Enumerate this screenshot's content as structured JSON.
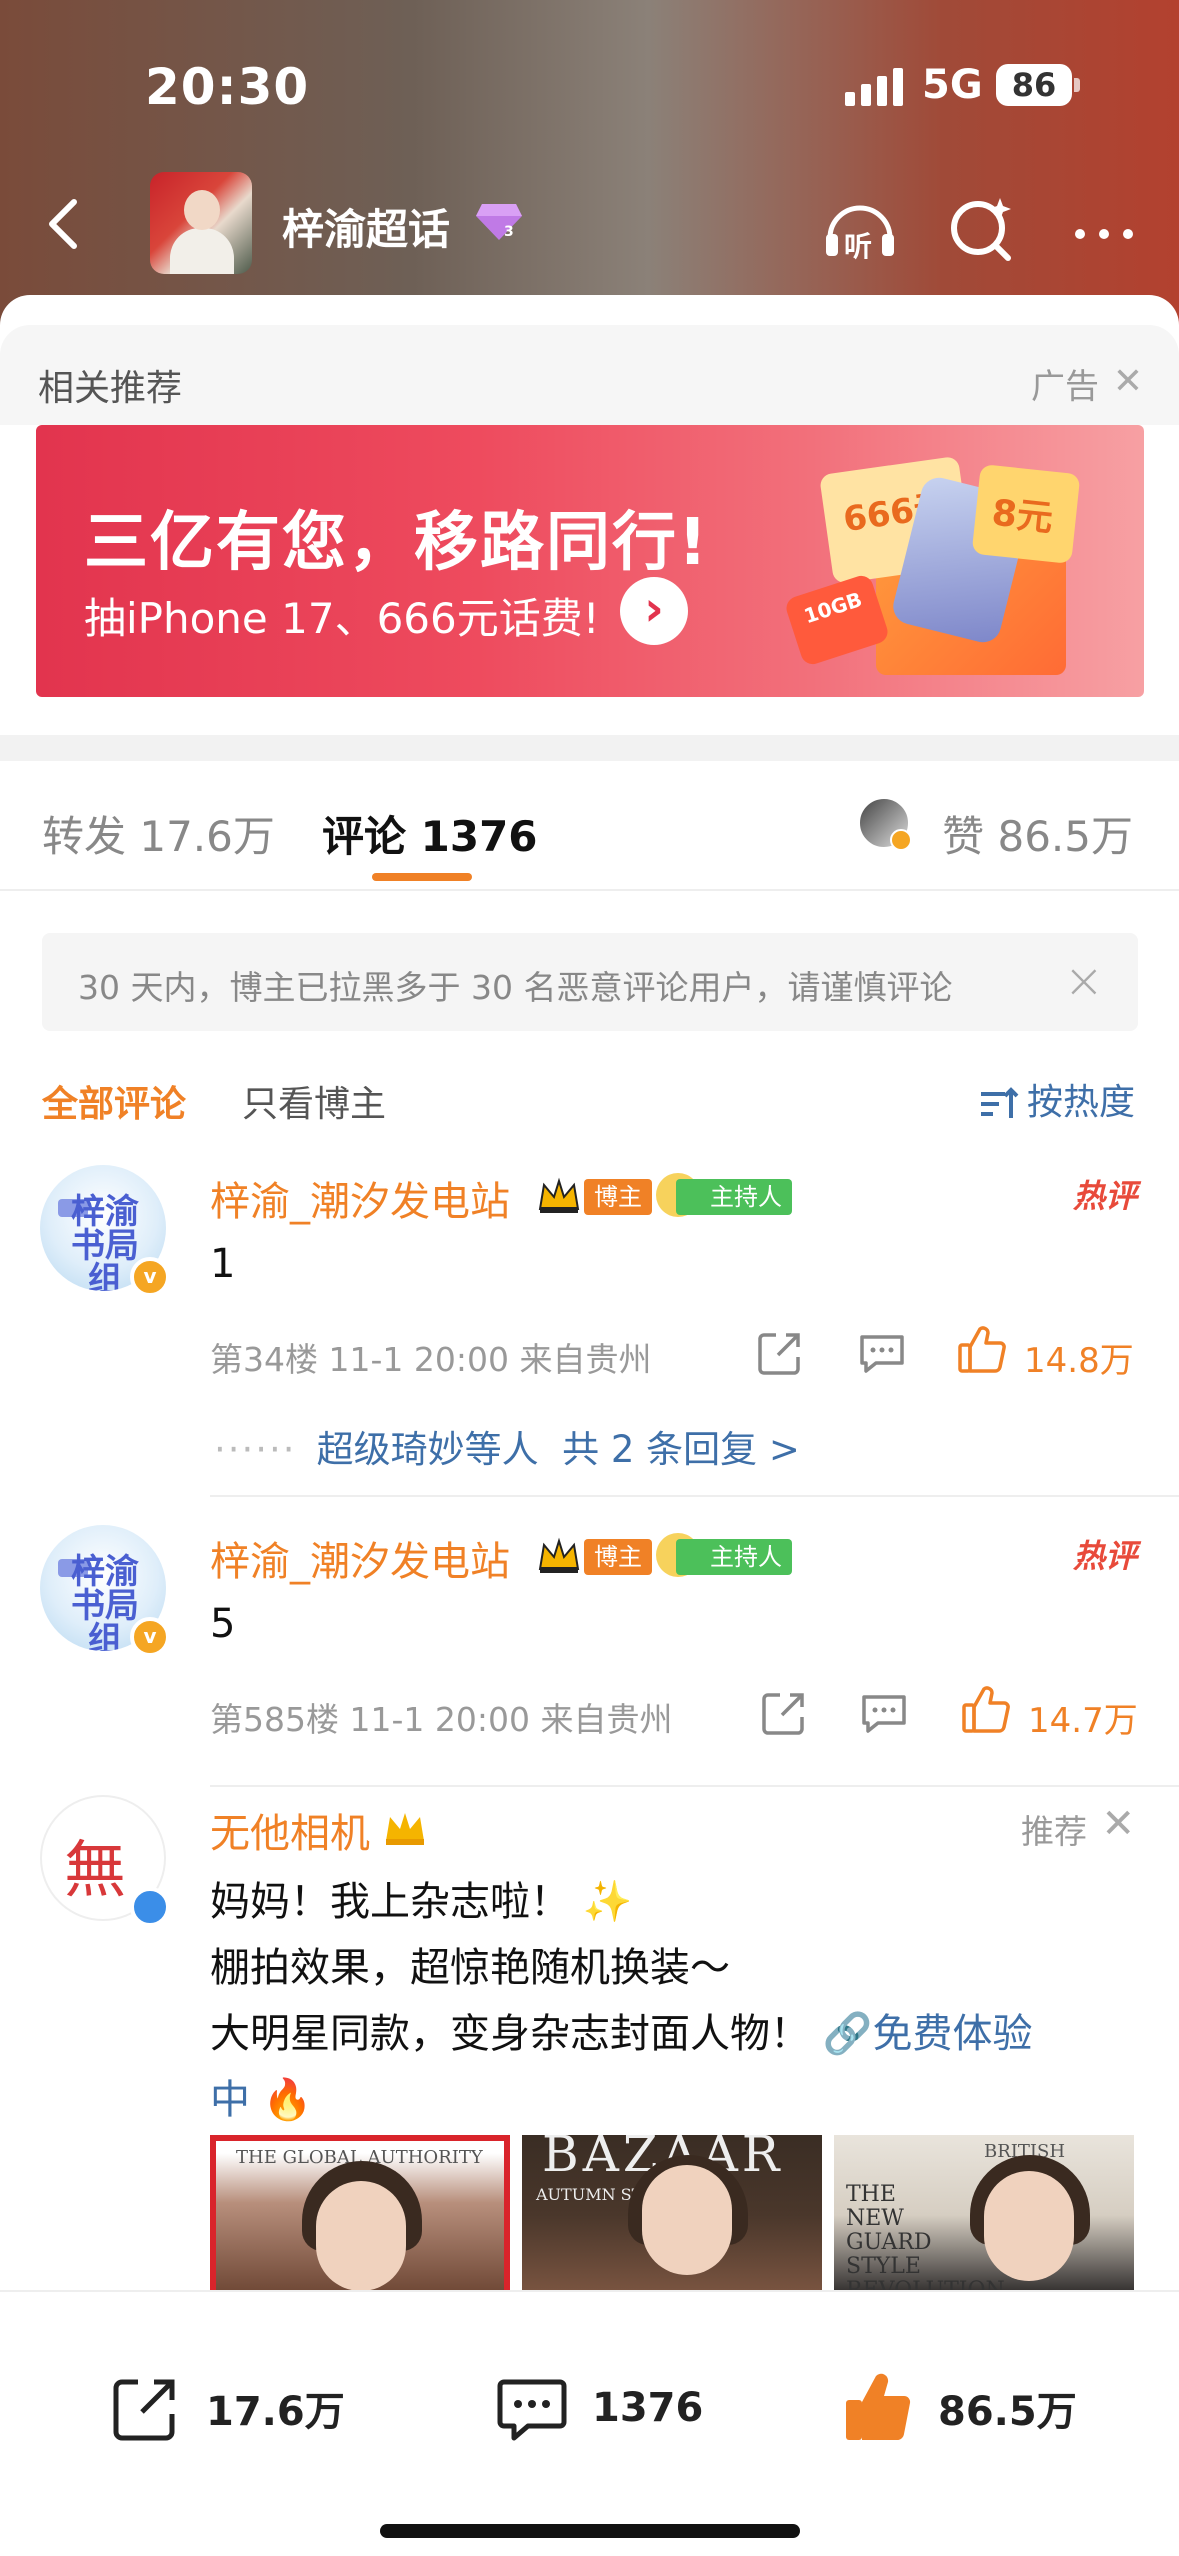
{
  "status_bar": {
    "time": "20:30",
    "network": "5G",
    "battery": "86"
  },
  "nav": {
    "title": "梓渝超话",
    "listen_label": "听"
  },
  "recommendation": {
    "title": "相关推荐",
    "ad_tag": "广告",
    "banner": {
      "headline": "三亿有您，移路同行!",
      "subline": "抽iPhone 17、666元话费!",
      "coupon_1": "666元",
      "coupon_2": "8元",
      "data_badge": "10GB"
    }
  },
  "tabs": {
    "repost": "转发 17.6万",
    "comment": "评论 1376",
    "like": "赞 86.5万"
  },
  "notice": {
    "text": "30 天内，博主已拉黑多于 30 名恶意评论用户，请谨慎评论"
  },
  "filters": {
    "all": "全部评论",
    "blogger_only": "只看博主",
    "sort": "按热度"
  },
  "comments": [
    {
      "avatar_text": "梓渝书局组",
      "name": "梓渝_潮汐发电站",
      "badge_host": "博主",
      "badge_mod": "主持人",
      "hot": "热评",
      "text": "1",
      "meta": "第34楼 11-1 20:00  来自贵州",
      "likes": "14.8万",
      "replies_prefix": "······",
      "replies_user": "超级琦妙等人",
      "replies_total": "共 2 条回复 >"
    },
    {
      "avatar_text": "梓渝书局组",
      "name": "梓渝_潮汐发电站",
      "badge_host": "博主",
      "badge_mod": "主持人",
      "hot": "热评",
      "text": "5",
      "meta": "第585楼 11-1 20:00  来自贵州",
      "likes": "14.7万"
    }
  ],
  "ad_comment": {
    "name": "无他相机",
    "recommend": "推荐",
    "line1": "妈妈！我上杂志啦！",
    "line2": "棚拍效果，超惊艳随机换装～",
    "line3": "大明星同款，变身杂志封面人物！",
    "link": "免费体验",
    "line4": "中",
    "thumb1_mast": "THE GLOBAL AUTHORITY",
    "thumb2_mast": "BAZAAR",
    "thumb2_sub": "AUTUMN STYLE",
    "thumb3_mast": "BRITISH",
    "thumb3_text": "THE NEW GUARD STYLE REVOLUTION"
  },
  "bottom_bar": {
    "repost": "17.6万",
    "comment": "1376",
    "like": "86.5万"
  },
  "colors": {
    "accent": "#f08126",
    "link": "#3e6fa8",
    "hot": "#e84a3a"
  }
}
